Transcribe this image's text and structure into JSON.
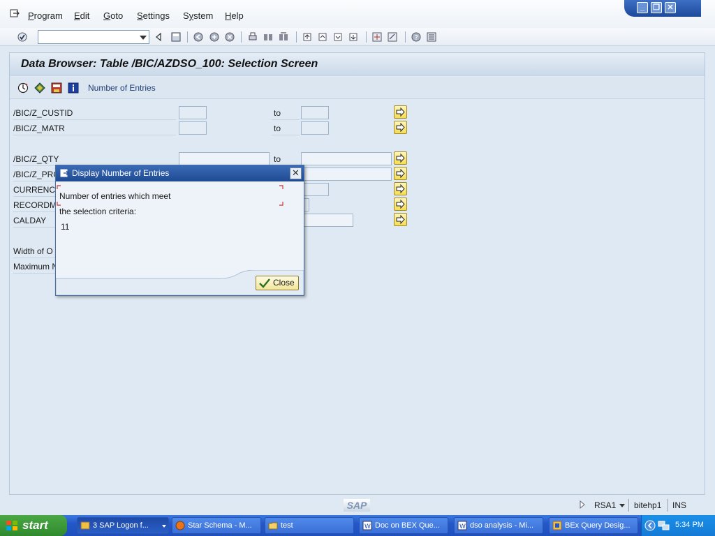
{
  "menubar": {
    "items": [
      "Program",
      "Edit",
      "Goto",
      "Settings",
      "System",
      "Help"
    ],
    "underline": [
      "P",
      "E",
      "G",
      "S",
      "y",
      "H"
    ]
  },
  "toolbar": {
    "command_field": ""
  },
  "screen": {
    "title": "Data Browser: Table /BIC/AZDSO_100: Selection Screen",
    "app_toolbar_label": "Number of Entries"
  },
  "selection": {
    "to_label": "to",
    "rows": [
      {
        "label": "/BIC/Z_CUSTID"
      },
      {
        "label": "/BIC/Z_MATR"
      },
      {
        "label": "/BIC/Z_QTY"
      },
      {
        "label": "/BIC/Z_PRO"
      },
      {
        "label": "CURRENCY"
      },
      {
        "label": "RECORDMO"
      },
      {
        "label": "CALDAY"
      }
    ],
    "width_label": "Width of O",
    "max_label": "Maximum N"
  },
  "dialog": {
    "title": "Display Number of Entries",
    "line1": "Number of entries which meet",
    "line2": "the selection criteria:",
    "count": "11",
    "close_label": "Close"
  },
  "status": {
    "sap_logo": "SAP",
    "transaction": "RSA1",
    "server": "bitehp1",
    "mode": "INS"
  },
  "taskbar": {
    "start_label": "start",
    "tasks": [
      {
        "label": "3 SAP Logon f...",
        "icon": "sap-logon-icon"
      },
      {
        "label": "Star Schema - M...",
        "icon": "firefox-icon"
      },
      {
        "label": "test",
        "icon": "folder-icon"
      },
      {
        "label": "Doc on BEX Que...",
        "icon": "word-icon"
      },
      {
        "label": "dso analysis - Mi...",
        "icon": "word-icon"
      },
      {
        "label": "BEx Query Desig...",
        "icon": "bex-icon"
      }
    ],
    "clock": "5:34 PM"
  },
  "colors": {
    "taskbar": "#2457c8",
    "start": "#2f8a2d",
    "dialog_title": "#2b5aa8",
    "multiselect_button": "#f5dd55"
  }
}
